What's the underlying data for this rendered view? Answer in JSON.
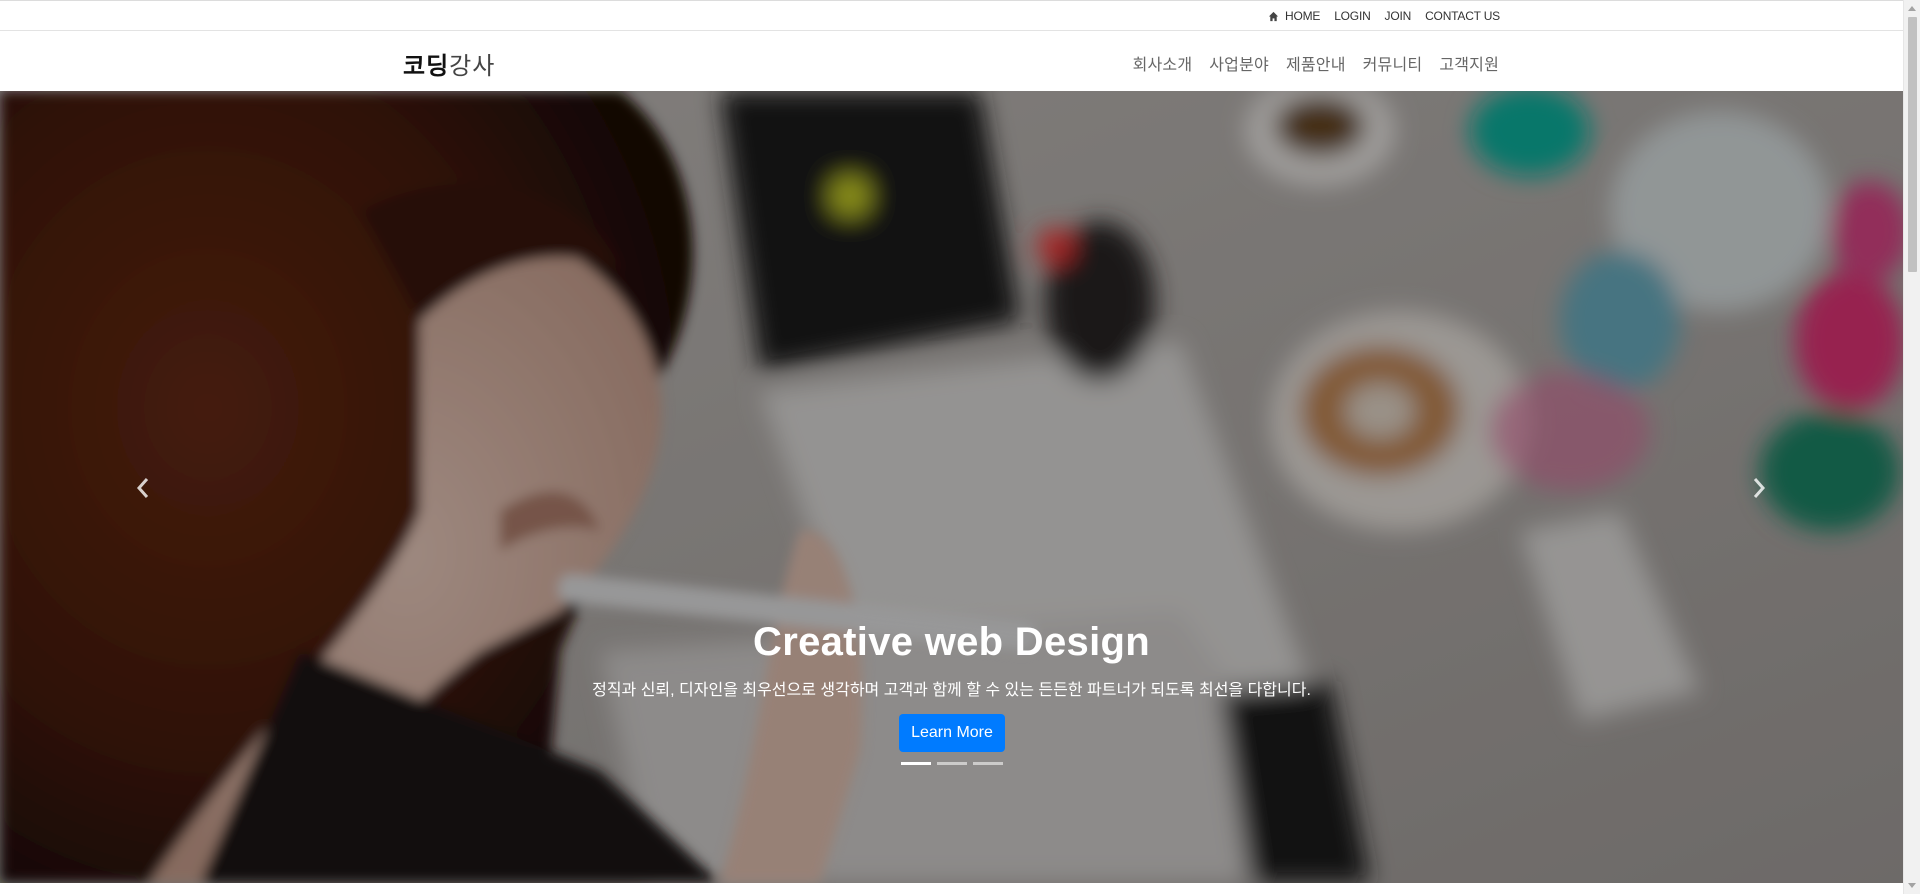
{
  "utility_nav": {
    "home": "HOME",
    "login": "LOGIN",
    "join": "JOIN",
    "contact": "CONTACT US"
  },
  "logo": {
    "bold": "코딩",
    "light": "강사"
  },
  "main_nav": [
    "회사소개",
    "사업분야",
    "제품안내",
    "커뮤니티",
    "고객지원"
  ],
  "hero": {
    "title": "Creative web Design",
    "subtitle": "정직과 신뢰, 디자인을 최우선으로 생각하며 고객과 함께 할 수 있는 든든한 파트너가 되도록 최선을 다합니다.",
    "button_label": "Learn More",
    "slide_count": 3,
    "active_slide": 1
  },
  "icons": {
    "home": "home-icon",
    "prev": "chevron-left-icon",
    "next": "chevron-right-icon"
  },
  "colors": {
    "button": "#007bff",
    "overlay": "rgba(0,0,0,0.35)"
  }
}
